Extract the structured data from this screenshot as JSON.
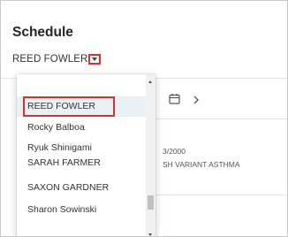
{
  "header": {
    "title": "Schedule",
    "patient_name": "REED FOWLER"
  },
  "background": {
    "date_fragment": "3/2000",
    "diagnosis_fragment": "SH VARIANT ASTHMA"
  },
  "dropdown": {
    "items": [
      {
        "label": "REED FOWLER",
        "selected": true
      },
      {
        "label": "Rocky Balboa"
      },
      {
        "label": "Ryuk Shinigami"
      },
      {
        "label": "SARAH FARMER"
      },
      {
        "label": "SAXON GARDNER"
      },
      {
        "label": "Sharon Sowinski"
      }
    ]
  },
  "colors": {
    "highlight_outline": "#d9322e",
    "selected_bg": "#e9f1f6",
    "text": "#333333"
  },
  "icons": [
    "caret-down-icon",
    "calendar-icon",
    "chevron-right-icon",
    "scroll-up-icon",
    "scroll-down-icon"
  ]
}
